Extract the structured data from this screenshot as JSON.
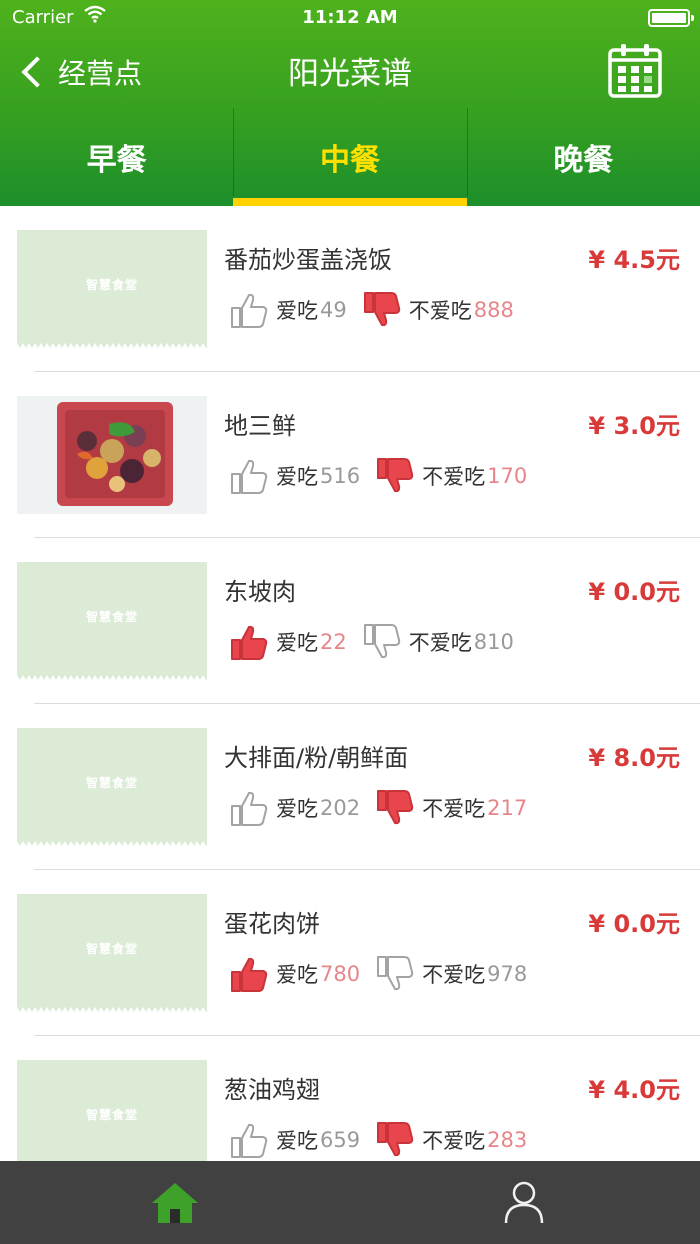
{
  "status_bar": {
    "carrier": "Carrier",
    "time": "11:12 AM"
  },
  "nav": {
    "back_label": "经营点",
    "title": "阳光菜谱"
  },
  "tabs": [
    {
      "label": "早餐",
      "active": false
    },
    {
      "label": "中餐",
      "active": true
    },
    {
      "label": "晚餐",
      "active": false
    }
  ],
  "placeholder_logo": "智慧食堂",
  "dishes": [
    {
      "name": "番茄炒蛋盖浇饭",
      "price": "¥ 4.5元",
      "like_label": "爱吃",
      "likes": "49",
      "dislike_label": "不爱吃",
      "dislikes": "888",
      "selected": "dislike",
      "image": "placeholder"
    },
    {
      "name": "地三鲜",
      "price": "¥ 3.0元",
      "like_label": "爱吃",
      "likes": "516",
      "dislike_label": "不爱吃",
      "dislikes": "170",
      "selected": "dislike",
      "image": "photo"
    },
    {
      "name": "东坡肉",
      "price": "¥ 0.0元",
      "like_label": "爱吃",
      "likes": "22",
      "dislike_label": "不爱吃",
      "dislikes": "810",
      "selected": "like",
      "image": "placeholder"
    },
    {
      "name": "大排面/粉/朝鲜面",
      "price": "¥ 8.0元",
      "like_label": "爱吃",
      "likes": "202",
      "dislike_label": "不爱吃",
      "dislikes": "217",
      "selected": "dislike",
      "image": "placeholder"
    },
    {
      "name": "蛋花肉饼",
      "price": "¥ 0.0元",
      "like_label": "爱吃",
      "likes": "780",
      "dislike_label": "不爱吃",
      "dislikes": "978",
      "selected": "like",
      "image": "placeholder"
    },
    {
      "name": "葱油鸡翅",
      "price": "¥ 4.0元",
      "like_label": "爱吃",
      "likes": "659",
      "dislike_label": "不爱吃",
      "dislikes": "283",
      "selected": "dislike",
      "image": "placeholder"
    }
  ],
  "colors": {
    "header_green": "#36a020",
    "active_tab": "#ffe100",
    "price_red": "#d83a3a",
    "selected_thumb_red": "#e8464c",
    "tabbar_bg": "#414141",
    "home_green": "#3ea12a"
  },
  "tabbar": {
    "items": [
      "home-icon",
      "profile-icon"
    ],
    "active": "home-icon"
  }
}
